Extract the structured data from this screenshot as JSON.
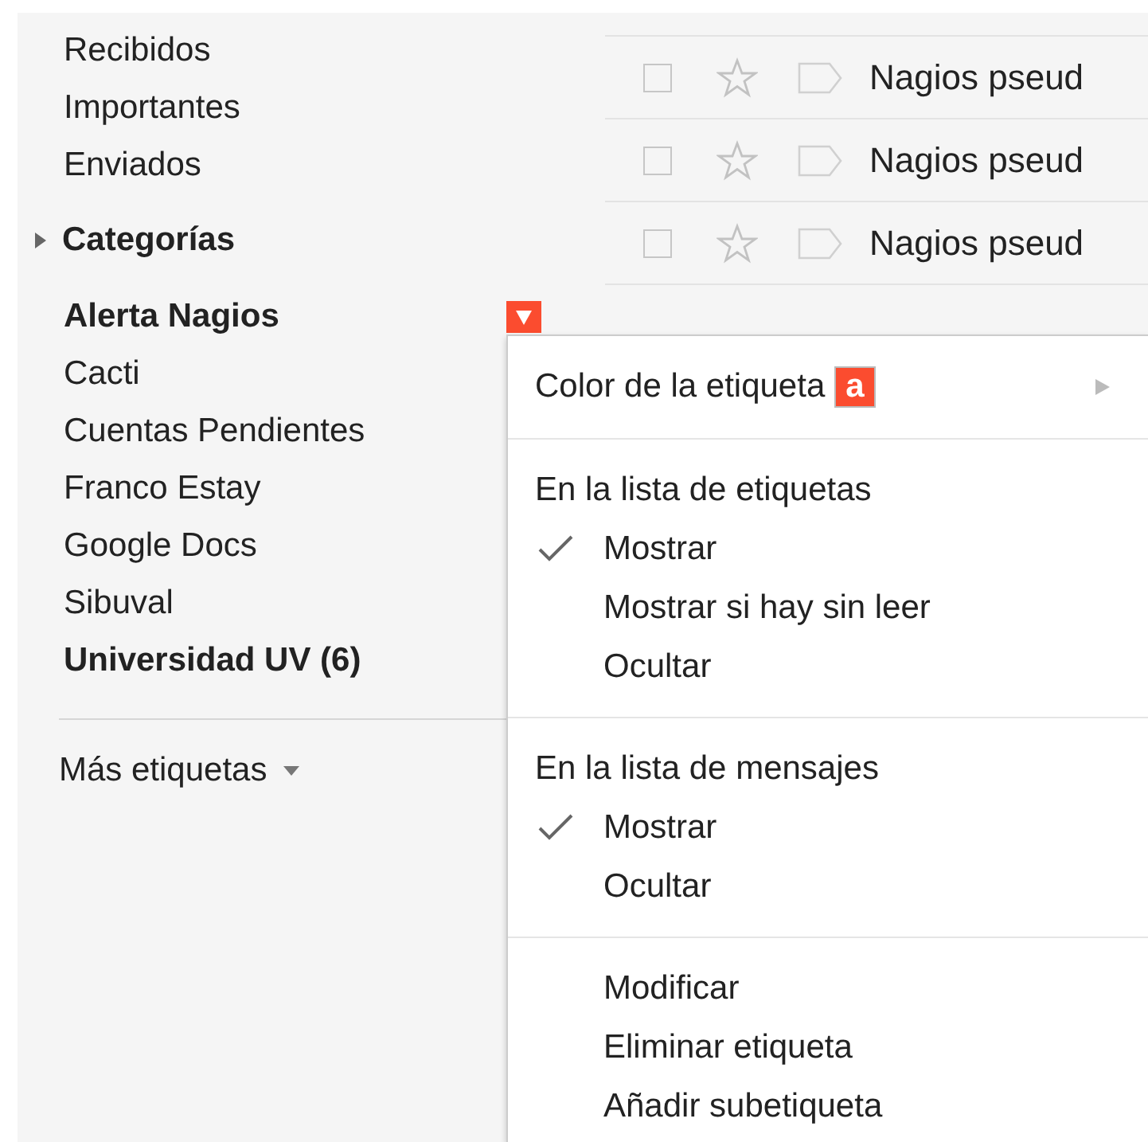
{
  "sidebar": {
    "items": [
      {
        "kind": "link",
        "label": "Recibidos",
        "unread": false,
        "selected": false
      },
      {
        "kind": "link",
        "label": "Importantes",
        "unread": false,
        "selected": false
      },
      {
        "kind": "link",
        "label": "Enviados",
        "unread": false,
        "selected": false
      },
      {
        "kind": "category",
        "label": "Categorías",
        "expanded": false
      },
      {
        "kind": "label",
        "label": "Alerta Nagios",
        "unread": true,
        "selected": true
      },
      {
        "kind": "label",
        "label": "Cacti",
        "unread": false,
        "selected": false
      },
      {
        "kind": "label",
        "label": "Cuentas Pendientes",
        "unread": false,
        "selected": false
      },
      {
        "kind": "label",
        "label": "Franco Estay",
        "unread": false,
        "selected": false
      },
      {
        "kind": "label",
        "label": "Google Docs",
        "unread": false,
        "selected": false
      },
      {
        "kind": "label",
        "label": "Sibuval",
        "unread": false,
        "selected": false
      },
      {
        "kind": "label",
        "label": "Universidad UV (6)",
        "unread": true,
        "selected": false
      }
    ],
    "more_labels": "Más etiquetas"
  },
  "messages": {
    "rows": [
      {
        "subject": "Nagios pseud",
        "checked": false,
        "starred": false
      },
      {
        "subject": "Nagios pseud",
        "checked": false,
        "starred": false
      },
      {
        "subject": "Nagios pseud",
        "checked": false,
        "starred": false
      }
    ]
  },
  "label_menu": {
    "sections": [
      {
        "items": [
          {
            "kind": "color",
            "label": "Color de la etiqueta",
            "swatch": "a"
          }
        ]
      },
      {
        "items": [
          {
            "kind": "header",
            "label": "En la lista de etiquetas"
          },
          {
            "kind": "option",
            "label": "Mostrar",
            "checked": true
          },
          {
            "kind": "option",
            "label": "Mostrar si hay sin leer",
            "checked": false
          },
          {
            "kind": "option",
            "label": "Ocultar",
            "checked": false
          }
        ]
      },
      {
        "items": [
          {
            "kind": "header",
            "label": "En la lista de mensajes"
          },
          {
            "kind": "option",
            "label": "Mostrar",
            "checked": true
          },
          {
            "kind": "option",
            "label": "Ocultar",
            "checked": false
          }
        ]
      },
      {
        "items": [
          {
            "kind": "action",
            "label": "Modificar"
          },
          {
            "kind": "action",
            "label": "Eliminar etiqueta"
          },
          {
            "kind": "action",
            "label": "Añadir subetiqueta"
          }
        ]
      }
    ]
  }
}
